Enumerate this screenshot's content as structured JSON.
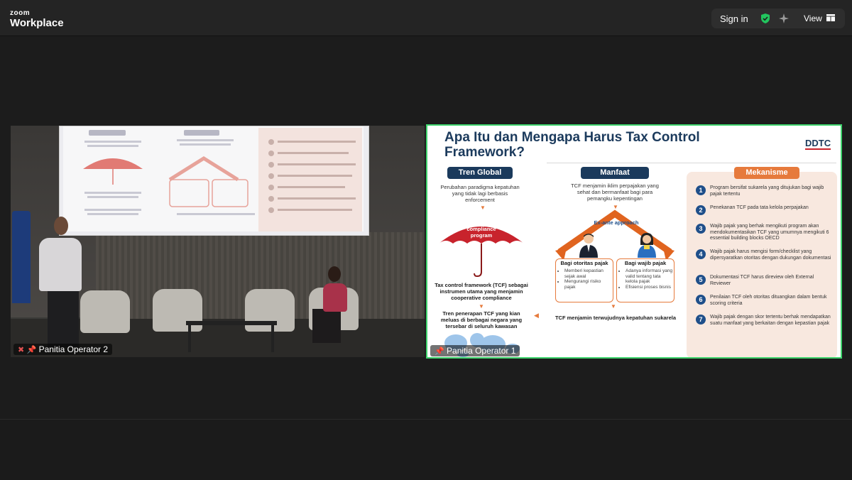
{
  "app": {
    "logo_top": "zoom",
    "logo_bottom": "Workplace"
  },
  "topbar": {
    "signin": "Sign in",
    "view": "View"
  },
  "tiles": [
    {
      "name": "Panitia Operator 2",
      "muted": true,
      "pinned": true
    },
    {
      "name": "Panitia Operator 1",
      "muted": false,
      "pinned": true
    }
  ],
  "slide": {
    "title": "Apa Itu dan Mengapa Harus Tax Control Framework?",
    "logo": "DDTC",
    "columns": {
      "tren_global": {
        "label": "Tren Global",
        "intro": "Perubahan paradigma kepatuhan yang tidak lagi berbasis enforcement",
        "umbrella": "Cooperative compliance program",
        "point1": "Tax control framework (TCF) sebagai instrumen utama yang menjamin cooperative compliance",
        "point2": "Tren penerapan TCF yang kian meluas di berbagai negara yang tersebar di seluruh kawasan"
      },
      "manfaat": {
        "label": "Manfaat",
        "intro": "TCF menjamin iklim perpajakan yang sehat dan bermanfaat bagi para pemangku kepentingan",
        "approach": "Ex-ante approach",
        "box1_title": "Bagi otoritas pajak",
        "box1_items": [
          "Memberi kepastian sejak awal",
          "Mengurangi risiko pajak"
        ],
        "box2_title": "Bagi wajib pajak",
        "box2_items": [
          "Adanya informasi yang valid tentang tata kelola pajak",
          "Efisiensi proses bisnis"
        ],
        "conclusion": "TCF menjamin terwujudnya kepatuhan sukarela"
      },
      "mekanisme": {
        "label": "Mekanisme",
        "items": [
          {
            "num": "1",
            "text": "Program bersifat sukarela yang ditujukan bagi wajib pajak tertentu"
          },
          {
            "num": "2",
            "text": "Penekanan TCF pada tata kelola perpajakan"
          },
          {
            "num": "3",
            "text": "Wajib pajak yang berhak mengikuti program akan mendokumentasikan TCF yang umumnya mengikuti 6 essential building blocks OECD"
          },
          {
            "num": "4",
            "text": "Wajib pajak harus mengisi form/checklist yang dipersyaratkan otoritas dengan dukungan dokumentasi"
          },
          {
            "num": "5",
            "text": "Dokumentasi TCF harus direview oleh External Reviewer"
          },
          {
            "num": "6",
            "text": "Penilaian TCF oleh otoritas dituangkan dalam bentuk scoring criteria"
          },
          {
            "num": "7",
            "text": "Wajib pajak dengan skor tertentu berhak mendapatkan suatu manfaat yang berkaitan dengan kepastian pajak"
          }
        ]
      }
    }
  },
  "colors": {
    "green_border": "#3ed36c",
    "navy": "#1b3a5c",
    "orange": "#e67a3c",
    "umbrella_red": "#c8232c"
  }
}
